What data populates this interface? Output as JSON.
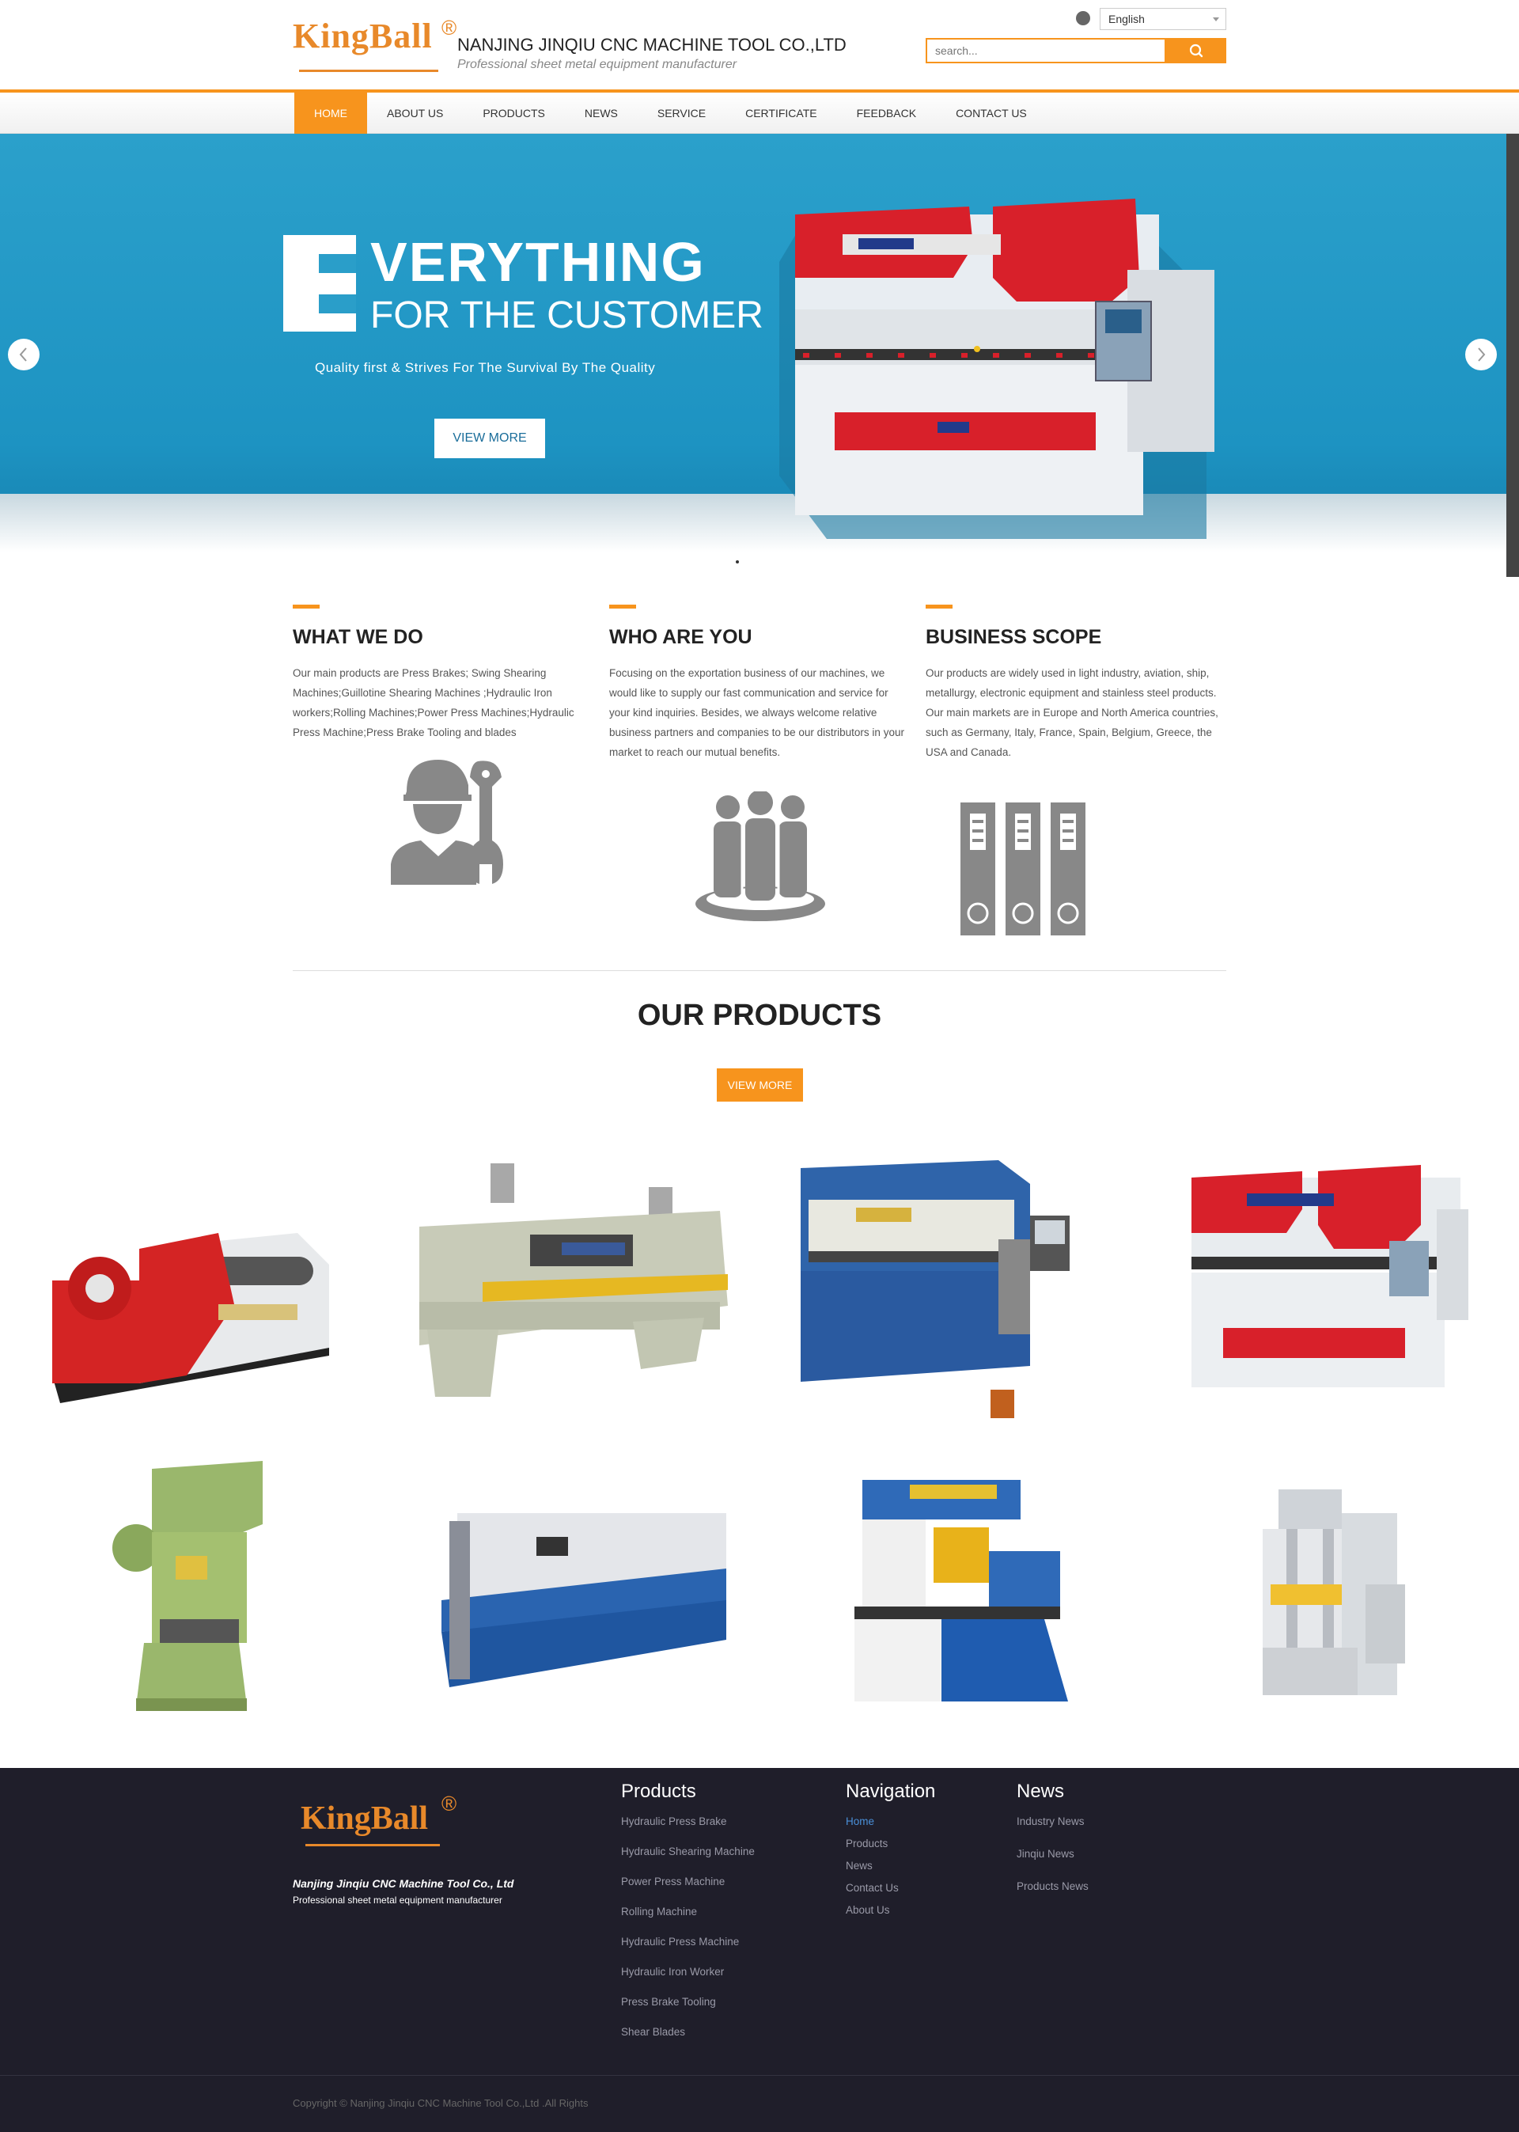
{
  "header": {
    "logo_text": "KingBall",
    "logo_reg": "®",
    "company_name": "NANJING JINQIU CNC MACHINE TOOL CO.,LTD",
    "slogan": "Professional sheet metal equipment manufacturer",
    "language": "English",
    "search_placeholder": "search..."
  },
  "nav": {
    "items": [
      "HOME",
      "ABOUT US",
      "PRODUCTS",
      "NEWS",
      "SERVICE",
      "CERTIFICATE",
      "FEEDBACK",
      "CONTACT US"
    ],
    "active": "HOME"
  },
  "banner": {
    "big_letter": "E",
    "title_line1": "VERYTHING",
    "title_line2": "FOR THE CUSTOMER",
    "tagline": "Quality  first & Strives For The Survival By The Quality",
    "button": "VIEW MORE"
  },
  "columns": [
    {
      "title": "WHAT WE DO",
      "text": " Our main products are  Press Brakes; Swing Shearing Machines;Guillotine Shearing Machines ;Hydraulic Iron workers;Rolling Machines;Power Press Machines;Hydraulic Press Machine;Press Brake Tooling and blades",
      "icon": "worker-wrench-icon"
    },
    {
      "title": "WHO ARE YOU",
      "text": "Focusing on the exportation business of our machines, we would like to supply our fast communication and service for your kind inquiries. Besides, we always welcome relative business partners and companies to be our distributors in your market to reach our mutual benefits.",
      "icon": "team-icon"
    },
    {
      "title": "BUSINESS SCOPE",
      "text": "Our products are widely used in light industry, aviation, ship, metallurgy, electronic equipment and stainless steel products. Our main markets are in Europe and North America countries, such as Germany, Italy, France, Spain, Belgium, Greece, the USA and Canada.",
      "icon": "binders-icon"
    }
  ],
  "products": {
    "title": "OUR PRODUCTS",
    "button": "VIEW MORE"
  },
  "footer": {
    "logo_text": "KingBall",
    "company": "Nanjing Jinqiu CNC Machine Tool Co., Ltd",
    "slogan": "Professional sheet metal equipment manufacturer",
    "products_title": "Products",
    "products_links": [
      "Hydraulic Press Brake",
      "Hydraulic Shearing Machine",
      "Power Press Machine",
      "Rolling Machine",
      "Hydraulic Press Machine",
      "Hydraulic Iron Worker",
      "Press Brake Tooling",
      "Shear Blades"
    ],
    "nav_title": "Navigation",
    "nav_links": [
      "Home",
      "Products",
      "News",
      "Contact Us",
      "About Us"
    ],
    "news_title": "News",
    "news_links": [
      "Industry News",
      "Jinqiu News",
      "Products News"
    ],
    "copyright": "Copyright © Nanjing Jinqiu CNC Machine Tool Co.,Ltd .All Rights"
  },
  "colors": {
    "accent": "#f7941d",
    "banner_blue": "#1d93c2",
    "footer_bg": "#1f1e2a",
    "nav_link_active": "#4a90d9"
  }
}
